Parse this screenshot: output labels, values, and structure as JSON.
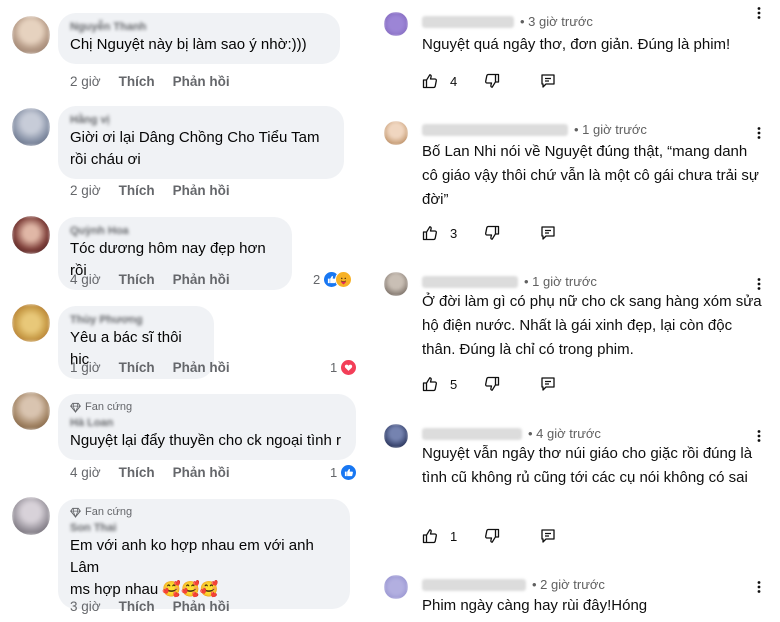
{
  "colors": {
    "fb_bubble": "#f0f2f5",
    "fb_meta": "#65676b",
    "yt_meta": "#606060",
    "like_blue": "#1877f2",
    "heart_red": "#f33e58",
    "care_yellow": "#f7b125"
  },
  "facebook": {
    "comments": [
      {
        "name": "Nguyễn Thanh",
        "text": "Chị Nguyệt này bị làm sao ý nhờ:)))",
        "time": "2 giờ",
        "like": "Thích",
        "reply": "Phản hồi",
        "avatar_color": "#b59a86"
      },
      {
        "name": "Hằng vị",
        "text": "Giời ơi lại Dâng Chồng Cho Tiểu Tam rồi cháu ơi",
        "time": "2 giờ",
        "like": "Thích",
        "reply": "Phản hồi",
        "avatar_color": "#7f8aa0"
      },
      {
        "name": "Quỳnh Hoa",
        "text": "Tóc dương hôm nay đẹp hơn rồi",
        "time": "4 giờ",
        "like": "Thích",
        "reply": "Phản hồi",
        "reactions": {
          "count": "2",
          "icons": [
            "like-icon",
            "care-icon"
          ]
        },
        "avatar_color": "#7a3a35"
      },
      {
        "name": "Thùy Phương",
        "text": "Yêu a bác sĩ thôi hic",
        "time": "1 giờ",
        "like": "Thích",
        "reply": "Phản hồi",
        "reactions": {
          "count": "1",
          "icons": [
            "heart-icon"
          ]
        },
        "avatar_color": "#c79a45"
      },
      {
        "badge": "Fan cứng",
        "name": "Hà Loan",
        "text": "Nguyệt lại đẩy thuyền cho ck ngoại tình r",
        "time": "4 giờ",
        "like": "Thích",
        "reply": "Phản hồi",
        "reactions": {
          "count": "1",
          "icons": [
            "like-icon"
          ]
        },
        "avatar_color": "#9c7d5c"
      },
      {
        "badge": "Fan cứng",
        "name": "Son Thai",
        "text_line1": "Em với anh ko hợp nhau em với anh Lâm",
        "text_line2": "ms hợp nhau 🥰🥰🥰",
        "time": "3 giờ",
        "like": "Thích",
        "reply": "Phản hồi",
        "avatar_color": "#8f8a93"
      }
    ]
  },
  "youtube": {
    "comments": [
      {
        "time": "• 3 giờ trước",
        "text": "Nguyệt quá ngây thơ, đơn giản.  Đúng là phim!",
        "likes": "4",
        "avatar_color": "#7a5fb5"
      },
      {
        "time": "• 1 giờ trước",
        "text": "Bố Lan Nhi nói về Nguyệt đúng thật, “mang danh cô giáo vậy thôi chứ vẫn là một cô gái chưa trải sự đời”",
        "likes": "3",
        "avatar_color": "#c9a07a"
      },
      {
        "time": "• 1 giờ trước",
        "text": "Ở đời làm gì có phụ nữ cho ck sang hàng xóm sửa hộ điện nước. Nhất là gái xinh đẹp, lại còn độc thân. Đúng là chỉ có trong phim.",
        "likes": "5",
        "avatar_color": "#8a7f76"
      },
      {
        "time": "• 4 giờ trước",
        "text": "Nguyệt vẫn ngây thơ núi giáo cho giặc rồi đúng là tình cũ không rủ cũng tới các cụ nói không có sai",
        "likes": "1",
        "avatar_color": "#3a4670"
      },
      {
        "time": "• 2 giờ trước",
        "text": "Phim ngày càng hay rùi đây!Hóng",
        "avatar_color": "#8b87c9"
      }
    ]
  }
}
